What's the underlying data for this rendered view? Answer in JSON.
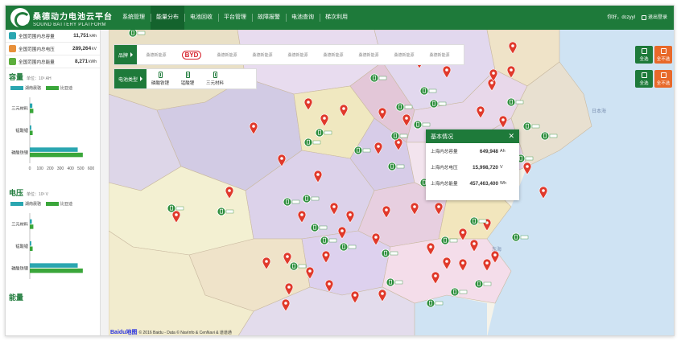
{
  "header": {
    "brand_cn": "桑德动力电池云平台",
    "brand_en": "SOUND BATTERY PLATFORM",
    "nav": [
      "系统管理",
      "能量分布",
      "电池回收",
      "平台管理",
      "故障报警",
      "电池查询",
      "梯次利用"
    ],
    "active_nav": 1,
    "greeting": "你好，dczyyl",
    "logout": "退出登录"
  },
  "summary": [
    {
      "label": "全国范围内总容量",
      "value": "11,751",
      "unit": "kAh",
      "color": "#2aa6b0"
    },
    {
      "label": "全国范围内总电压",
      "value": "289,264",
      "unit": "kV",
      "color": "#e8903a"
    },
    {
      "label": "全国范围内总能量",
      "value": "8,271",
      "unit": "kWh",
      "color": "#5cae3c"
    }
  ],
  "capacity": {
    "title": "容量",
    "unit": "单位：10³ AH",
    "legend": [
      "湖南晨骆",
      "比亚迪"
    ],
    "categories": [
      "三元材料",
      "锰酸锂",
      "磷酸铁锂"
    ],
    "x_ticks": [
      "0",
      "100",
      "200",
      "300",
      "400",
      "500",
      "600"
    ]
  },
  "voltage": {
    "title": "电压",
    "unit": "单位：10³ V",
    "legend": [
      "湖南晨骆",
      "比亚迪"
    ],
    "categories": [
      "三元材料",
      "锰酸锂",
      "磷酸铁锂"
    ]
  },
  "energy": {
    "title": "能量"
  },
  "chart_data": [
    {
      "type": "bar",
      "title": "容量",
      "categories": [
        "三元材料",
        "锰酸锂",
        "磷酸铁锂"
      ],
      "series": [
        {
          "name": "湖南晨骆",
          "values": [
            25,
            15,
            470
          ]
        },
        {
          "name": "比亚迪",
          "values": [
            35,
            28,
            520
          ]
        }
      ],
      "xlim": [
        0,
        600
      ]
    },
    {
      "type": "bar",
      "title": "电压",
      "categories": [
        "三元材料",
        "锰酸锂",
        "磷酸铁锂"
      ],
      "series": [
        {
          "name": "湖南晨骆",
          "values": [
            20,
            15,
            470
          ]
        },
        {
          "name": "比亚迪",
          "values": [
            35,
            28,
            520
          ]
        }
      ],
      "xlim": [
        0,
        600
      ]
    }
  ],
  "filters": {
    "brand_label": "品牌",
    "brands": [
      "桑德新能源",
      "BYD",
      "桑德新能源",
      "桑德新能源",
      "桑德新能源",
      "桑德新能源",
      "桑德新能源",
      "桑德新能源",
      "桑德新能源"
    ],
    "type_label": "电池类型",
    "types": [
      "磷酸铁锂",
      "锰酸锂",
      "三元材料"
    ],
    "select_all": "全选",
    "select_none": "全不选"
  },
  "popup": {
    "title": "基本情况",
    "rows": [
      {
        "label": "上海内总容量",
        "value": "649,948",
        "unit": "Ah"
      },
      {
        "label": "上海内总电压",
        "value": "15,998,720",
        "unit": "V"
      },
      {
        "label": "上海内总能量",
        "value": "457,463,400",
        "unit": "Wh"
      }
    ]
  },
  "map": {
    "labels": [
      "日本海",
      "东海"
    ],
    "footer": "© 2016 Baidu - Data © NavInfo & CenNavi & 道道通",
    "baidu": "Baidu地图"
  },
  "colors": {
    "primary": "#1e7a3a",
    "bar1": "#2aa6b0",
    "bar2": "#3aa63a",
    "marker": "#e0392b",
    "orange": "#e8692a"
  }
}
